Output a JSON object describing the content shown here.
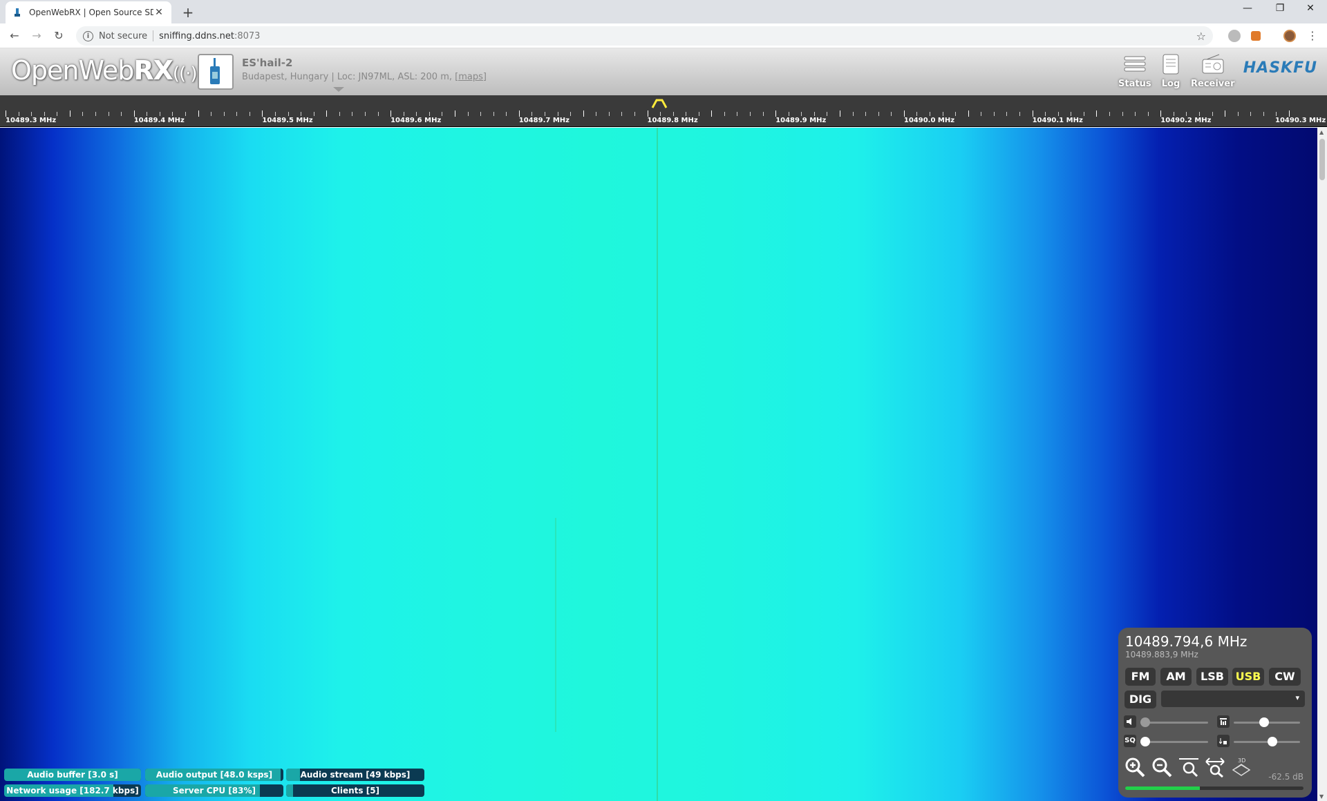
{
  "browser": {
    "tab_title": "OpenWebRX | Open Source SDR",
    "close_glyph": "✕",
    "new_tab_glyph": "+",
    "window_controls": [
      "—",
      "❐",
      "✕"
    ],
    "back_glyph": "←",
    "forward_glyph": "→",
    "reload_glyph": "↻",
    "info_glyph": "i",
    "not_secure": "Not secure",
    "url_host": "sniffing.ddns.net",
    "url_port": ":8073",
    "bookmark_glyph": "☆",
    "menu_glyph": "⋮"
  },
  "header": {
    "logo_left": "OpenWeb",
    "logo_right": "RX",
    "logo_suffix": "((·))",
    "receiver_name": "ES'hail-2",
    "receiver_desc": "Budapest, Hungary | Loc: JN97ML, ASL: 200 m, ",
    "maps_link": "[maps]",
    "buttons": {
      "status": "Status",
      "log": "Log",
      "receiver": "Receiver"
    },
    "sponsor": "HASKFU"
  },
  "scale": {
    "labels": [
      "10489.3 MHz",
      "10489.4 MHz",
      "10489.5 MHz",
      "10489.6 MHz",
      "10489.7 MHz",
      "10489.8 MHz",
      "10489.9 MHz",
      "10490.0 MHz",
      "10490.1 MHz",
      "10490.2 MHz",
      "10490.3 MHz"
    ]
  },
  "status": {
    "audio_buffer": {
      "label": "Audio buffer [3.0 s]",
      "fill": 1.0
    },
    "audio_output": {
      "label": "Audio output [48.0 ksps]",
      "fill": 0.98
    },
    "audio_stream": {
      "label": "Audio stream [49 kbps]",
      "fill": 0.1
    },
    "network_usage": {
      "label": "Network usage [182.7 kbps]",
      "fill": 0.8
    },
    "server_cpu": {
      "label": "Server CPU [83%]",
      "fill": 0.83
    },
    "clients": {
      "label": "Clients [5]",
      "fill": 0.05
    }
  },
  "receiver": {
    "frequency": "10489.794,6 MHz",
    "offset_frequency": "10489.883,9 MHz",
    "modes": [
      "FM",
      "AM",
      "LSB",
      "USB",
      "CW"
    ],
    "active_mode": "USB",
    "dig_label": "DIG",
    "dig_selected": "",
    "dropdown_glyph": "▾",
    "squelch_label": "SQ",
    "volume_level": 0.0,
    "squelch_level": 0.0,
    "waterfall_max_level": 0.45,
    "waterfall_min_level": 0.6,
    "db_readout": "-62.5 dB",
    "smeter_level": 0.42
  },
  "colors": {
    "accent_yellow": "#ffff50",
    "status_fill": "#1aa7a7",
    "status_bg": "#0b3a52",
    "panel_bg": "#575757"
  }
}
